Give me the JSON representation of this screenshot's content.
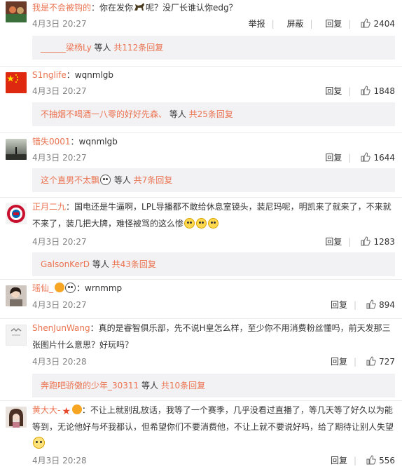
{
  "comments": [
    {
      "author": "我是不会被钩的",
      "text_a": "：你在发你",
      "text_b": "呢？没厂长谁认你edg？",
      "icon": "horse-icon",
      "time": "4月3日 20:27",
      "report": "举报",
      "block": "屏蔽",
      "reply": "回复",
      "likes": "2404",
      "thread": {
        "names": "______梁杨Ly",
        "mid": " 等人 ",
        "count": "共112条回复"
      }
    },
    {
      "author": "S1nglife",
      "text_a": "：wqnmlgb",
      "time": "4月3日 20:27",
      "reply": "回复",
      "likes": "1848",
      "thread": {
        "names": "不抽烟不喝酒一八零的好好先森、",
        "mid": " 等人 ",
        "count": "共25条回复"
      }
    },
    {
      "author": "错失0001",
      "text_a": "：wqnmlgb",
      "time": "4月3日 20:27",
      "reply": "回复",
      "likes": "1644",
      "thread": {
        "names": "这个直男不太飘",
        "mid": " 等人 ",
        "count": "共7条回复",
        "icon": "panda-icon"
      }
    },
    {
      "author": "正月二九",
      "text_a": "：国电还是牛逼啊，LPL导播都不敢给休息室镜头，装尼玛呢，明凯来了就来了，不来就",
      "text_b": "不来了，装几把大牌，难怪被骂的这么惨",
      "time": "4月3日 20:27",
      "reply": "回复",
      "likes": "1283",
      "thread": {
        "names": "GalsonKerD",
        "mid": " 等人 ",
        "count": "共43条回复"
      }
    },
    {
      "author": "瑶仙_",
      "text_a": "：wrnmmp",
      "time": "4月3日 20:27",
      "reply": "回复",
      "likes": "894"
    },
    {
      "author": "ShenJunWang",
      "text_a": "：真的是睿智俱乐部，先不说H皇怎么样，至少你不用消费粉丝懂吗，前天发那三",
      "text_b": "张图片什么意思？好玩吗？",
      "time": "4月3日 20:28",
      "reply": "回复",
      "likes": "727",
      "thread": {
        "names": "奔跑吧骄傲的少年_30311",
        "mid": " 等人 ",
        "count": "共10条回复"
      }
    },
    {
      "author": "黄大大-",
      "text_a": "：不让上就别乱放话，我等了一个赛季，几乎没看过直播了，等几天等了好久以为能",
      "text_b": "等到，无论他好与坏我都认，但希望你们不要消费他，不让上就不要说好吗，给了期待让别人失望",
      "time": "4月3日 20:28",
      "reply": "回复",
      "likes": "556"
    }
  ],
  "colors": {
    "author": "#eb7350",
    "thread_bg": "#f2f2f5",
    "time": "#808080"
  }
}
